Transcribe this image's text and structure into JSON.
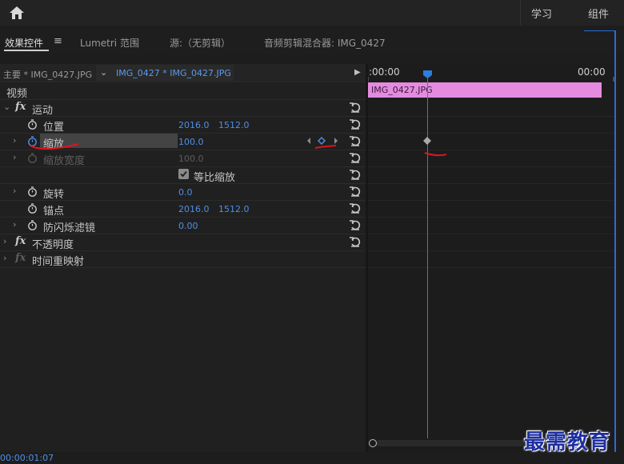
{
  "workspaces": {
    "learn": "学习",
    "assemble": "组件"
  },
  "tabs": {
    "effect_controls": "效果控件",
    "menu_icon": "≡",
    "lumetri": "Lumetri 范围",
    "source": "源:（无剪辑）",
    "audio_mixer": "音频剪辑混合器: IMG_0427"
  },
  "clip_header": {
    "master": "主要 * IMG_0427.JPG",
    "sequence_clip": "IMG_0427 * IMG_0427.JPG",
    "chevron": "⌄",
    "play": "▶"
  },
  "sections": {
    "video": "视频"
  },
  "effects": {
    "motion": {
      "name": "运动",
      "fx": "fx",
      "position": {
        "label": "位置",
        "x": "2016.0",
        "y": "1512.0"
      },
      "scale": {
        "label": "缩放",
        "value": "100.0"
      },
      "scale_width": {
        "label": "缩放宽度",
        "value": "100.0"
      },
      "uniform_scale": {
        "label": "等比缩放",
        "checked": true
      },
      "rotation": {
        "label": "旋转",
        "value": "0.0"
      },
      "anchor": {
        "label": "锚点",
        "x": "2016.0",
        "y": "1512.0"
      },
      "flicker": {
        "label": "防闪烁滤镜",
        "value": "0.00"
      }
    },
    "opacity": {
      "name": "不透明度",
      "fx": "fx"
    },
    "time_remap": {
      "name": "时间重映射",
      "fx": "fx"
    }
  },
  "timeline": {
    "start_tc": ":00:00",
    "end_tc": "00:00",
    "clip_label": "IMG_0427.JPG",
    "clip_color": "#e48be0",
    "playhead_color": "#2b7de0"
  },
  "footer": {
    "timecode": "00:00:01:07"
  },
  "watermark": "最需教育",
  "colors": {
    "value_blue": "#4f8fe6",
    "annotation_red": "#e0141e"
  }
}
